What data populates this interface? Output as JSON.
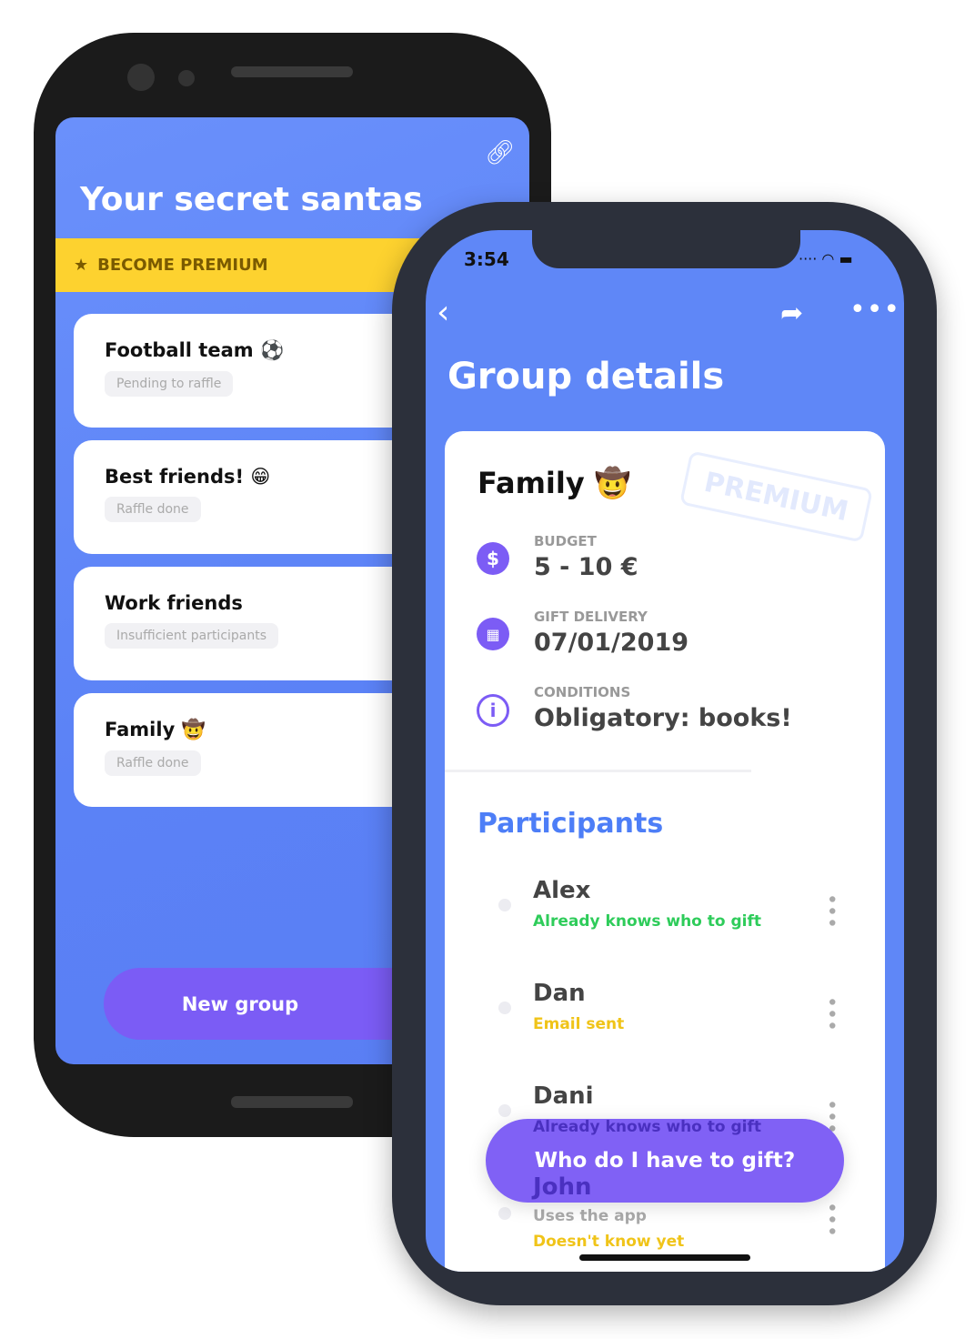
{
  "back_phone": {
    "title": "Your secret santas",
    "premium_label": "BECOME PREMIUM",
    "groups": [
      {
        "name": "Football team ⚽",
        "status": "Pending to raffle"
      },
      {
        "name": "Best friends! 😁",
        "status": "Raffle done"
      },
      {
        "name": "Work friends",
        "status": "Insufficient participants"
      },
      {
        "name": "Family 🤠",
        "status": "Raffle done"
      }
    ],
    "new_group_label": "New group"
  },
  "front_phone": {
    "time": "3:54",
    "title": "Group details",
    "group": {
      "name": "Family 🤠",
      "stamp": "PREMIUM",
      "budget_label": "BUDGET",
      "budget": "5 - 10 €",
      "delivery_label": "GIFT DELIVERY",
      "delivery": "07/01/2019",
      "conditions_label": "CONDITIONS",
      "conditions": "Obligatory: books!"
    },
    "participants_title": "Participants",
    "participants": [
      {
        "name": "Alex",
        "status": "Already knows who to gift"
      },
      {
        "name": "Dan",
        "status": "Email sent"
      },
      {
        "name": "Dani",
        "status": "Already knows who to gift"
      },
      {
        "name": "John",
        "status": "Uses the app",
        "status2": "Doesn't know yet"
      }
    ],
    "cta_label": "Who do I have to gift?"
  },
  "colors": {
    "blue": "#5f87f7",
    "purple": "#7b5cf5",
    "yellow": "#fdd22f",
    "green": "#2ecc5a",
    "amber": "#f0c419"
  }
}
